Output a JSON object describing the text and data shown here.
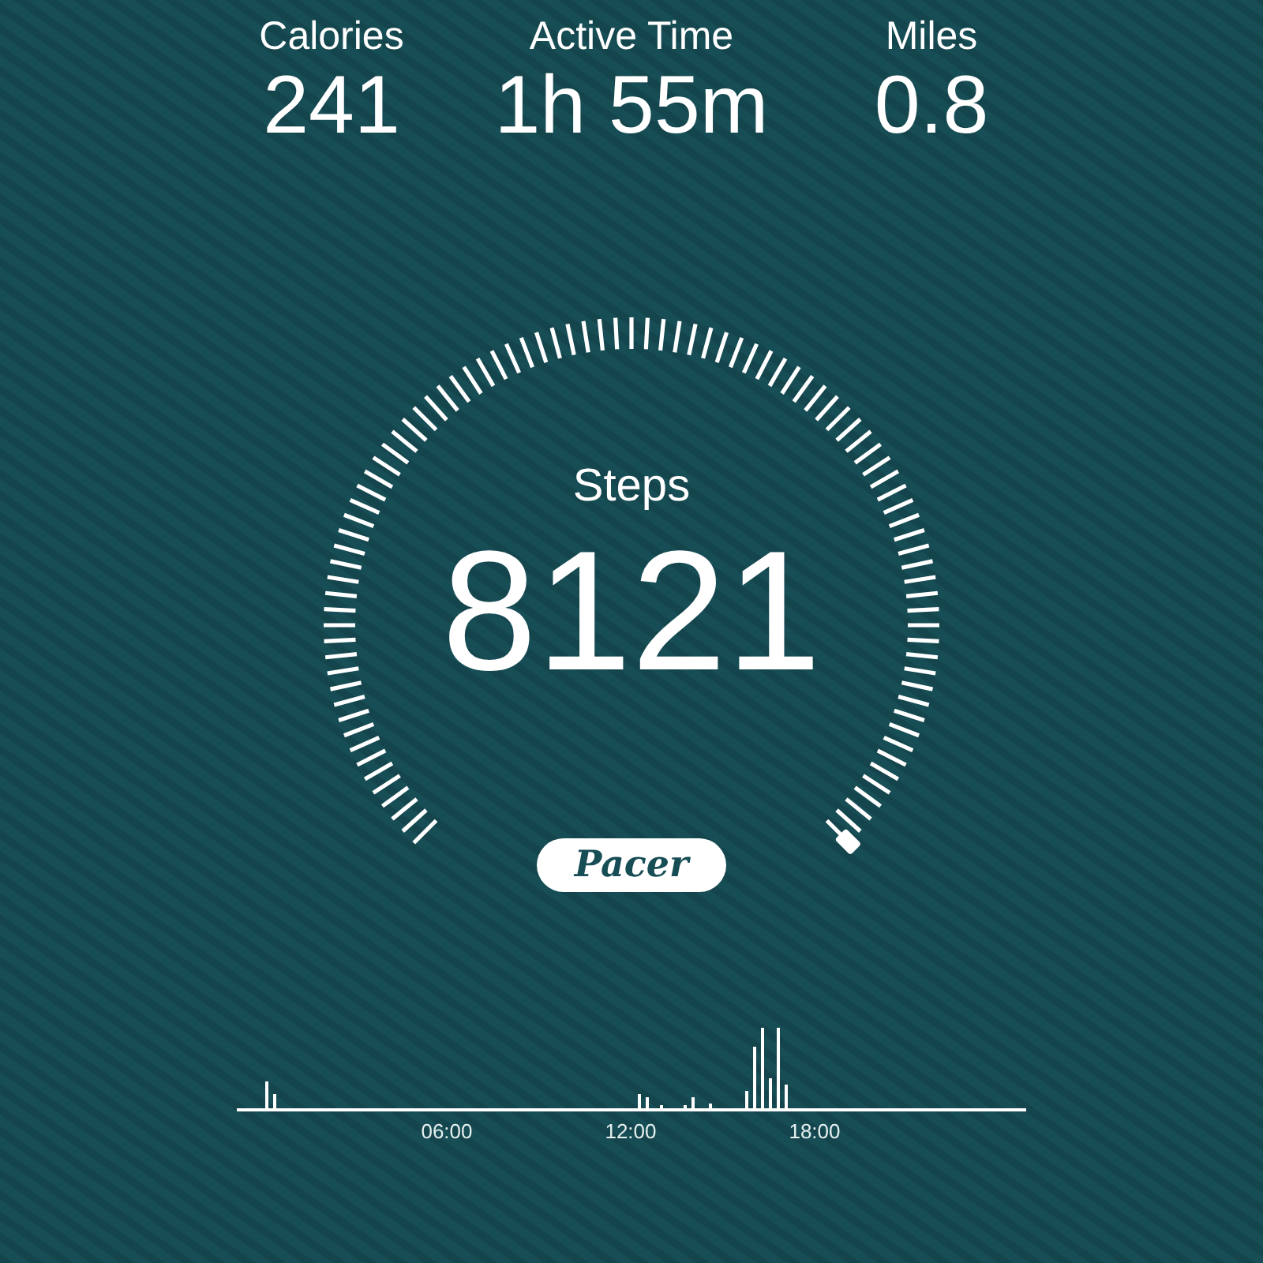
{
  "stats": [
    {
      "label": "Calories",
      "value": "241"
    },
    {
      "label": "Active Time",
      "value": "1h 55m"
    },
    {
      "label": "Miles",
      "value": "0.8"
    }
  ],
  "gauge": {
    "label": "Steps",
    "value": "8121"
  },
  "logo": "Pacer",
  "activity_chart": {
    "x_labels": [
      "06:00",
      "12:00",
      "18:00"
    ]
  }
}
